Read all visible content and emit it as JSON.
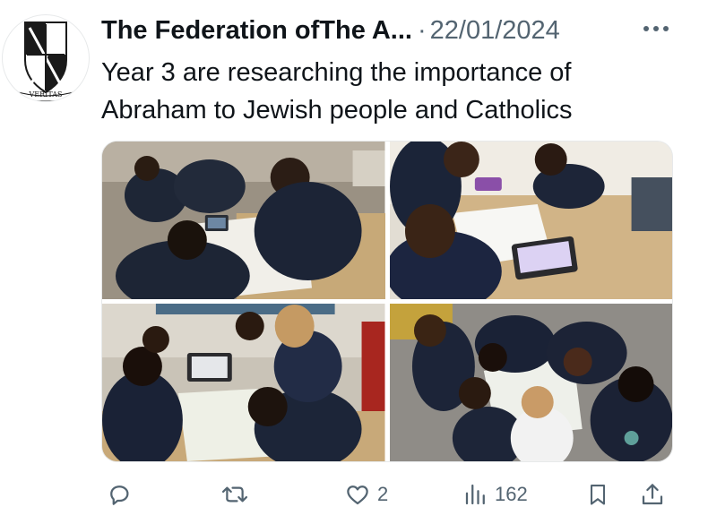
{
  "post": {
    "author_name": "The Federation ofThe A...",
    "separator": "·",
    "date": "22/01/2024",
    "text": "Year 3 are researching the importance of Abraham to Jewish people and Catholics",
    "avatar_motto": "VERITAS"
  },
  "actions": {
    "reply_icon": "reply-icon",
    "repost_icon": "repost-icon",
    "like_count": "2",
    "views_count": "162"
  },
  "colors": {
    "text": "#0f1419",
    "secondary": "#536471"
  }
}
